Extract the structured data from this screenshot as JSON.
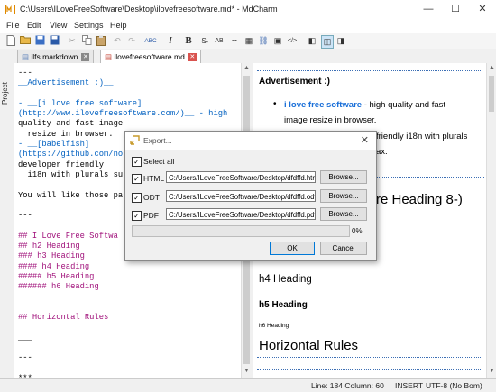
{
  "window": {
    "title": "C:\\Users\\ILoveFreeSoftware\\Desktop\\ilovefreesoftware.md* - MdCharm"
  },
  "menu": [
    "File",
    "Edit",
    "View",
    "Settings",
    "Help"
  ],
  "sidebar": {
    "label": "Project"
  },
  "tabs": [
    {
      "label": "ilfs.markdown"
    },
    {
      "label": "ilovefreesoftware.md"
    }
  ],
  "editor": {
    "lines": [
      {
        "text": "---",
        "color": "#000000"
      },
      {
        "text": "__Advertisement :)__",
        "color": "#0060c0"
      },
      {
        "text": "",
        "color": "#000000"
      },
      {
        "text": "- __[i love free software]",
        "color": "#0060c0"
      },
      {
        "text": "(http://www.ilovefreesoftware.com/)__ - high",
        "color": "#0060c0"
      },
      {
        "text": "quality and fast image",
        "color": "#000000"
      },
      {
        "text": "  resize in browser.",
        "color": "#000000"
      },
      {
        "text": "- __[babelfish]",
        "color": "#0060c0"
      },
      {
        "text": "(https://github.com/no",
        "color": "#0060c0"
      },
      {
        "text": "developer friendly",
        "color": "#000000"
      },
      {
        "text": "  i18n with plurals su",
        "color": "#000000"
      },
      {
        "text": "",
        "color": "#000000"
      },
      {
        "text": "You will like those pa",
        "color": "#000000"
      },
      {
        "text": "",
        "color": "#000000"
      },
      {
        "text": "---",
        "color": "#000000"
      },
      {
        "text": "",
        "color": "#000000"
      },
      {
        "text": "## I Love Free Softwa",
        "color": "#a0107a"
      },
      {
        "text": "## h2 Heading",
        "color": "#a0107a"
      },
      {
        "text": "### h3 Heading",
        "color": "#a0107a"
      },
      {
        "text": "#### h4 Heading",
        "color": "#a0107a"
      },
      {
        "text": "##### h5 Heading",
        "color": "#a0107a"
      },
      {
        "text": "###### h6 Heading",
        "color": "#a0107a"
      },
      {
        "text": "",
        "color": "#000000"
      },
      {
        "text": "",
        "color": "#000000"
      },
      {
        "text": "## Horizontal Rules",
        "color": "#a0107a"
      },
      {
        "text": "",
        "color": "#000000"
      },
      {
        "text": "___",
        "color": "#000000"
      },
      {
        "text": "",
        "color": "#000000"
      },
      {
        "text": "---",
        "color": "#000000"
      },
      {
        "text": "",
        "color": "#000000"
      },
      {
        "text": "***",
        "color": "#000000"
      }
    ]
  },
  "preview": {
    "ad_heading": "Advertisement :)",
    "item1_link": "i love free software",
    "item1_text": " - high quality and fast",
    "item1_text2": "image resize in browser.",
    "item2_text": "friendly i18n with plurals",
    "item2_text2": "ax.",
    "big_heading_fragment": "re Heading 8-)",
    "h4": "h4 Heading",
    "h5": "h5 Heading",
    "h6": "h6 Heading",
    "h2_rules": "Horizontal Rules"
  },
  "dialog": {
    "title": "Export...",
    "select_all": "Select all",
    "rows": [
      {
        "label": "HTML",
        "path": "C:/Users/ILoveFreeSoftware/Desktop/dfdffd.html",
        "browse": "Browse..."
      },
      {
        "label": "ODT",
        "path": "C:/Users/ILoveFreeSoftware/Desktop/dfdffd.odt",
        "browse": "Browse..."
      },
      {
        "label": "PDF",
        "path": "C:/Users/ILoveFreeSoftware/Desktop/dfdffd.pdf",
        "browse": "Browse..."
      }
    ],
    "progress_value": 0,
    "progress_text": "0%",
    "ok": "OK",
    "cancel": "Cancel"
  },
  "status": {
    "position": "Line: 184 Column: 60",
    "mode": "INSERT",
    "encoding": "UTF-8 (No Bom)"
  },
  "colors": {
    "link": "#0060c0",
    "heading_md": "#a0107a",
    "preview_link": "#1a6fd8",
    "dotted_rule": "#3c6fb5"
  }
}
